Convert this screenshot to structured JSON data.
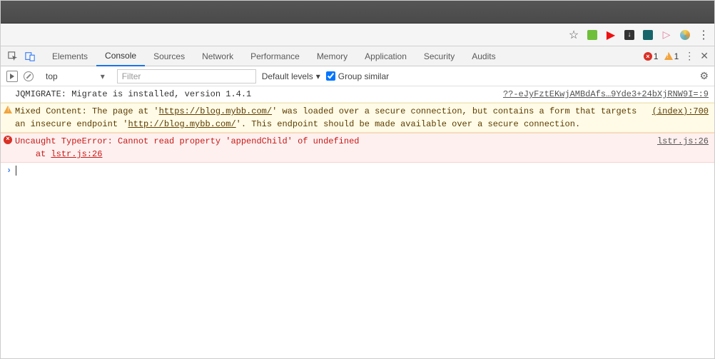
{
  "devtools": {
    "tabs": {
      "elements": "Elements",
      "console": "Console",
      "sources": "Sources",
      "network": "Network",
      "performance": "Performance",
      "memory": "Memory",
      "application": "Application",
      "security": "Security",
      "audits": "Audits"
    },
    "error_count": "1",
    "warn_count": "1"
  },
  "console_toolbar": {
    "context": "top",
    "filter_placeholder": "Filter",
    "levels_label": "Default levels",
    "group_similar_label": "Group similar",
    "group_similar_checked": true
  },
  "messages": {
    "log1": {
      "text": "JQMIGRATE: Migrate is installed, version 1.4.1",
      "source": "??-eJyFztEKwjAMBdAfs…9Yde3+24bXjRNW9I=:9"
    },
    "warn1": {
      "prefix": "Mixed Content: The page at '",
      "url1": "https://blog.mybb.com/",
      "mid": "' was loaded over a secure connection, but contains a form that targets an insecure endpoint '",
      "url2": "http://blog.mybb.com/",
      "suffix": "'. This endpoint should be made available over a secure connection.",
      "source": "(index):700"
    },
    "err1": {
      "line1": "Uncaught TypeError: Cannot read property 'appendChild' of undefined",
      "line2_prefix": "    at ",
      "line2_link": "lstr.js:26",
      "source": "lstr.js:26"
    }
  }
}
